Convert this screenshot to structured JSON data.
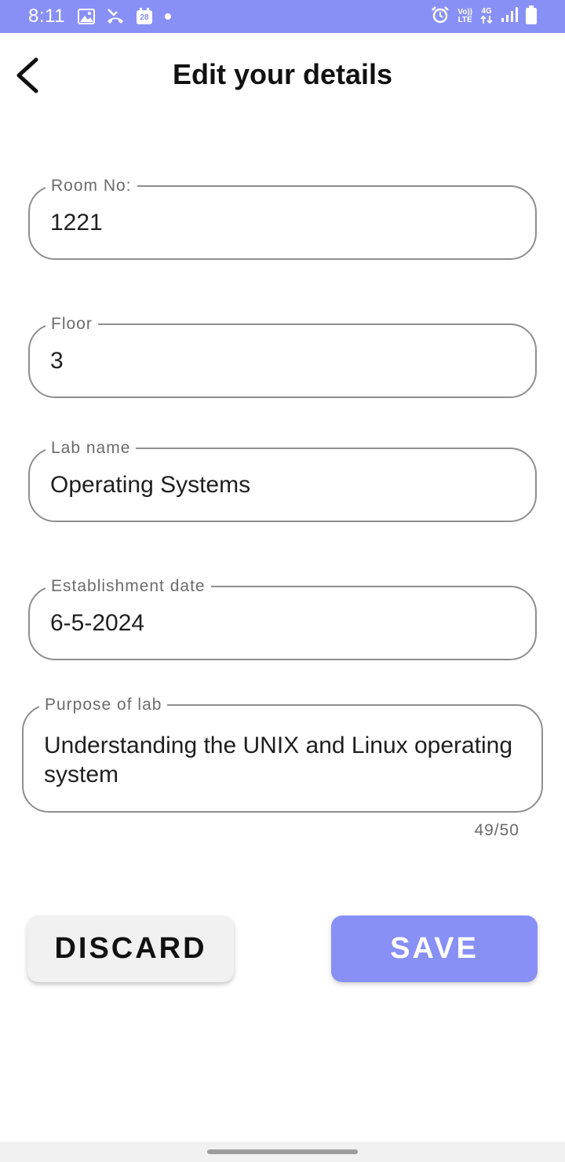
{
  "status_bar": {
    "time": "8:11",
    "calendar_day": "28",
    "network_label_top": "Vo))",
    "network_label_bottom": "LTE",
    "network_gen": "4G",
    "icons": [
      "gallery-icon",
      "missed-call-icon",
      "calendar-icon",
      "notification-dot-icon",
      "alarm-icon",
      "volte-icon",
      "data-arrows-icon",
      "signal-icon",
      "battery-icon"
    ],
    "color": "#8990f5"
  },
  "header": {
    "title": "Edit your details",
    "back_icon": "back-arrow-icon"
  },
  "form": {
    "room_no": {
      "label": "Room No:",
      "value": "1221"
    },
    "floor": {
      "label": "Floor",
      "value": "3"
    },
    "lab_name": {
      "label": "Lab name",
      "value": "Operating Systems"
    },
    "establishment_date": {
      "label": "Establishment date",
      "value": "6-5-2024"
    },
    "purpose": {
      "label": "Purpose of lab",
      "value": "Understanding the UNIX and Linux operating system",
      "counter": "49/50"
    }
  },
  "actions": {
    "discard_label": "DISCARD",
    "save_label": "SAVE",
    "accent_color": "#8890f5"
  }
}
